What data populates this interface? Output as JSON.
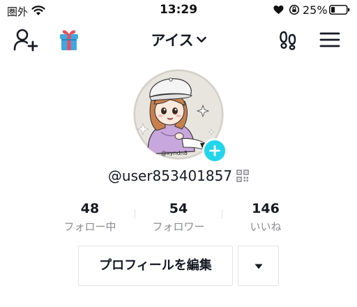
{
  "status_bar": {
    "carrier": "圏外",
    "time": "13:29",
    "battery_percent": "25%",
    "battery_level": 0.25
  },
  "header": {
    "title": "アイス",
    "icons": [
      "add-user-icon",
      "gift-icon",
      "chevron-down-icon",
      "footprint-icon",
      "menu-icon"
    ]
  },
  "profile": {
    "username": "@user853401857",
    "avatar_caption": "@xyndn8"
  },
  "stats": [
    {
      "value": "48",
      "label": "フォロー中"
    },
    {
      "value": "54",
      "label": "フォロワー"
    },
    {
      "value": "146",
      "label": "いいね"
    }
  ],
  "actions": {
    "edit_profile_label": "プロフィールを編集"
  },
  "colors": {
    "accent": "#20d5ec",
    "text": "#161823",
    "muted": "#8a8b91",
    "border": "#e3e3e4",
    "gift_red": "#ef4b5a",
    "gift_blue": "#3fa7e0"
  }
}
